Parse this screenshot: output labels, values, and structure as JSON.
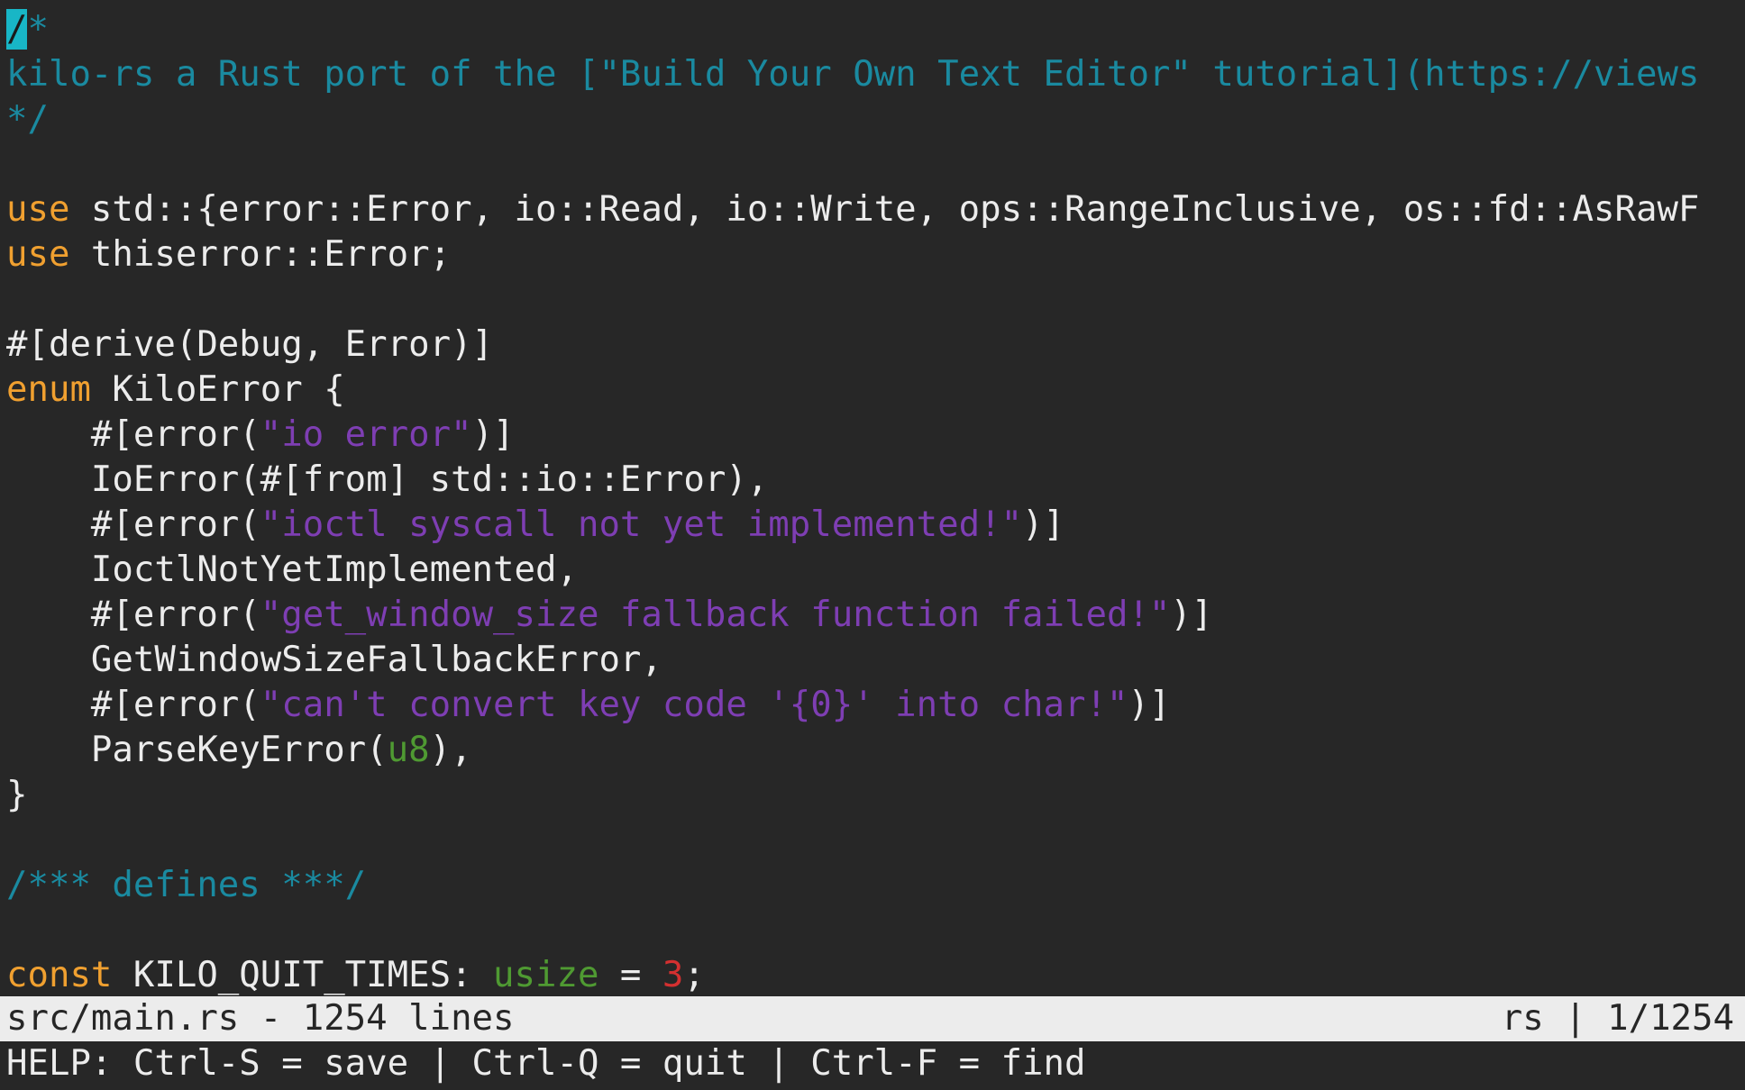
{
  "editor": {
    "lines": [
      [
        {
          "t": "/",
          "c": "cursor"
        },
        {
          "t": "*",
          "c": "cmt"
        }
      ],
      [
        {
          "t": "kilo-rs a Rust port of the [\"Build Your Own Text Editor\" tutorial](https://views",
          "c": "cmt"
        }
      ],
      [
        {
          "t": "*/",
          "c": "cmt"
        }
      ],
      [],
      [
        {
          "t": "use",
          "c": "kw"
        },
        {
          "t": " std::{error::Error, io::Read, io::Write, ops::RangeInclusive, os::fd::AsRawF",
          "c": ""
        }
      ],
      [
        {
          "t": "use",
          "c": "kw"
        },
        {
          "t": " thiserror::Error;",
          "c": ""
        }
      ],
      [],
      [
        {
          "t": "#[derive(Debug, Error)]",
          "c": ""
        }
      ],
      [
        {
          "t": "enum",
          "c": "kw"
        },
        {
          "t": " KiloError {",
          "c": ""
        }
      ],
      [
        {
          "t": "    #[error(",
          "c": ""
        },
        {
          "t": "\"io error\"",
          "c": "str"
        },
        {
          "t": ")]",
          "c": ""
        }
      ],
      [
        {
          "t": "    IoError(#[from] std::io::Error),",
          "c": ""
        }
      ],
      [
        {
          "t": "    #[error(",
          "c": ""
        },
        {
          "t": "\"ioctl syscall not yet implemented!\"",
          "c": "str"
        },
        {
          "t": ")]",
          "c": ""
        }
      ],
      [
        {
          "t": "    IoctlNotYetImplemented,",
          "c": ""
        }
      ],
      [
        {
          "t": "    #[error(",
          "c": ""
        },
        {
          "t": "\"get_window_size fallback function failed!\"",
          "c": "str"
        },
        {
          "t": ")]",
          "c": ""
        }
      ],
      [
        {
          "t": "    GetWindowSizeFallbackError,",
          "c": ""
        }
      ],
      [
        {
          "t": "    #[error(",
          "c": ""
        },
        {
          "t": "\"can't convert key code '{0}' into char!\"",
          "c": "str"
        },
        {
          "t": ")]",
          "c": ""
        }
      ],
      [
        {
          "t": "    ParseKeyError(",
          "c": ""
        },
        {
          "t": "u8",
          "c": "ty"
        },
        {
          "t": "),",
          "c": ""
        }
      ],
      [
        {
          "t": "}",
          "c": ""
        }
      ],
      [],
      [
        {
          "t": "/*** defines ***/",
          "c": "cmt"
        }
      ],
      [],
      [
        {
          "t": "const",
          "c": "kw"
        },
        {
          "t": " KILO_QUIT_TIMES: ",
          "c": ""
        },
        {
          "t": "usize",
          "c": "ty"
        },
        {
          "t": " = ",
          "c": ""
        },
        {
          "t": "3",
          "c": "num"
        },
        {
          "t": ";",
          "c": ""
        }
      ]
    ]
  },
  "status_bar": {
    "filename": "src/main.rs",
    "left_text": "src/main.rs - 1254 lines",
    "right_text": "rs | 1/1254"
  },
  "help_bar": {
    "text": "HELP: Ctrl-S = save | Ctrl-Q = quit | Ctrl-F = find"
  },
  "colors": {
    "background": "#272727",
    "text": "#ececec",
    "comment": "#1a8aa0",
    "keyword": "#f0a030",
    "string": "#7e3eb3",
    "type": "#4f9a32",
    "number": "#d43030",
    "cursor": "#18b6c6",
    "status_bg": "#ececec",
    "status_fg": "#262626"
  }
}
